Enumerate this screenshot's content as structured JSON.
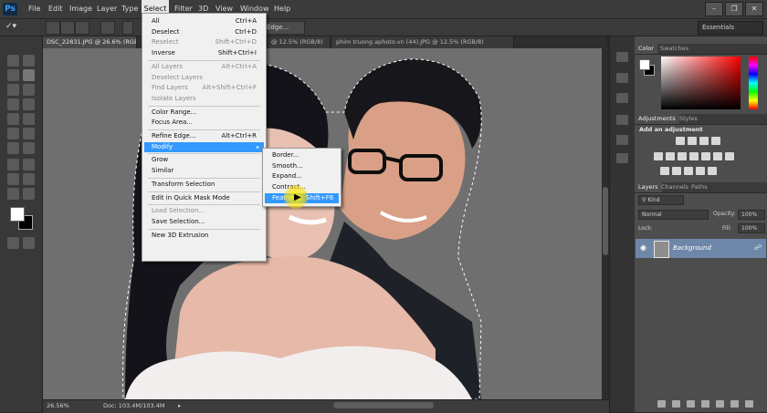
{
  "app": {
    "logo": "Ps"
  },
  "menubar": {
    "items": [
      "File",
      "Edit",
      "Image",
      "Layer",
      "Type",
      "Select",
      "Filter",
      "3D",
      "View",
      "Window",
      "Help"
    ],
    "active": "Select",
    "window_controls": [
      "minimize-icon",
      "restore-icon",
      "close-icon"
    ]
  },
  "options_bar": {
    "edge_button": "Edge...",
    "workspace": "Essentials"
  },
  "tabs": [
    {
      "label": "DSC_22831.JPG @ 26.6% (RGB/8)"
    },
    {
      "label": "@ 12.5% (RGB/8)"
    },
    {
      "label": "phim truong aphoto.vn (44).JPG @ 12.5% (RGB/8)"
    }
  ],
  "select_menu": {
    "items": [
      {
        "label": "All",
        "shortcut": "Ctrl+A",
        "enabled": true
      },
      {
        "label": "Deselect",
        "shortcut": "Ctrl+D",
        "enabled": true
      },
      {
        "label": "Reselect",
        "shortcut": "Shift+Ctrl+D",
        "enabled": false
      },
      {
        "label": "Inverse",
        "shortcut": "Shift+Ctrl+I",
        "enabled": true
      },
      {
        "separator": true
      },
      {
        "label": "All Layers",
        "shortcut": "Alt+Ctrl+A",
        "enabled": false
      },
      {
        "label": "Deselect Layers",
        "shortcut": "",
        "enabled": false
      },
      {
        "label": "Find Layers",
        "shortcut": "Alt+Shift+Ctrl+F",
        "enabled": false
      },
      {
        "label": "Isolate Layers",
        "shortcut": "",
        "enabled": false
      },
      {
        "separator": true
      },
      {
        "label": "Color Range...",
        "shortcut": "",
        "enabled": true
      },
      {
        "label": "Focus Area...",
        "shortcut": "",
        "enabled": true
      },
      {
        "separator": true
      },
      {
        "label": "Refine Edge...",
        "shortcut": "Alt+Ctrl+R",
        "enabled": true
      },
      {
        "label": "Modify",
        "shortcut": "",
        "enabled": true,
        "submenu": true,
        "highlighted": true
      },
      {
        "separator": true
      },
      {
        "label": "Grow",
        "shortcut": "",
        "enabled": true
      },
      {
        "label": "Similar",
        "shortcut": "",
        "enabled": true
      },
      {
        "separator": true
      },
      {
        "label": "Transform Selection",
        "shortcut": "",
        "enabled": true
      },
      {
        "separator": true
      },
      {
        "label": "Edit in Quick Mask Mode",
        "shortcut": "",
        "enabled": true
      },
      {
        "separator": true
      },
      {
        "label": "Load Selection...",
        "shortcut": "",
        "enabled": false
      },
      {
        "label": "Save Selection...",
        "shortcut": "",
        "enabled": true
      },
      {
        "separator": true
      },
      {
        "label": "New 3D Extrusion",
        "shortcut": "",
        "enabled": true
      }
    ]
  },
  "modify_submenu": {
    "items": [
      {
        "label": "Border...",
        "shortcut": ""
      },
      {
        "label": "Smooth...",
        "shortcut": ""
      },
      {
        "label": "Expand...",
        "shortcut": ""
      },
      {
        "label": "Contract...",
        "shortcut": ""
      },
      {
        "label": "Feather...",
        "shortcut": "Shift+F6",
        "highlighted": true
      }
    ]
  },
  "status": {
    "zoom": "26.56%",
    "doc": "Doc: 103.4M/103.4M"
  },
  "panels": {
    "color_tabs": [
      "Color",
      "Swatches"
    ],
    "adjustments_tabs": [
      "Adjustments",
      "Styles"
    ],
    "adjustments_title": "Add an adjustment",
    "layers_tabs": [
      "Layers",
      "Channels",
      "Paths"
    ],
    "kind_filter": "Kind",
    "blend_mode": "Normal",
    "opacity_label": "Opacity:",
    "opacity_value": "100%",
    "lock_label": "Lock:",
    "fill_label": "Fill:",
    "fill_value": "100%",
    "layer_name": "Background"
  },
  "colors": {
    "accent": "#3399ff",
    "layer_selected": "#6d87a8",
    "ui_dark": "#3b3b3b"
  }
}
